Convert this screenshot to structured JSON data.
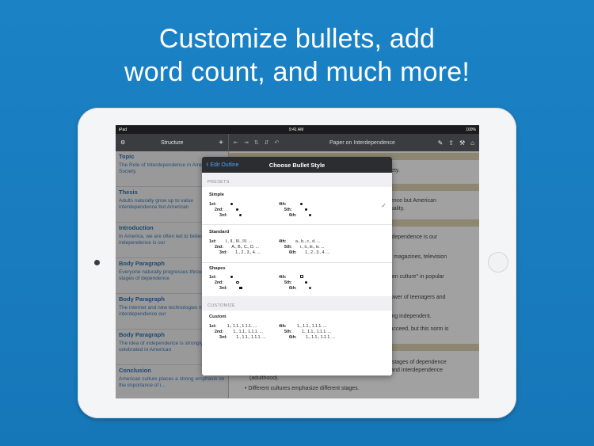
{
  "headline": {
    "line1": "Customize bullets, add",
    "line2": "word count, and much more!"
  },
  "status_bar": {
    "device": "iPad",
    "time": "9:41 AM",
    "battery": "100%"
  },
  "sidebar": {
    "title": "Structure",
    "settings_icon": "gear-icon",
    "add_label": "+",
    "items": [
      {
        "title": "Topic",
        "text": "The Role of Interdependence in American Society."
      },
      {
        "title": "Thesis",
        "text": "Adults naturally grow up to value interdependence but American"
      },
      {
        "title": "Introduction",
        "text": "In America, we are often led to believe that independence is our"
      },
      {
        "title": "Body Paragraph",
        "text": "Everyone naturally progresses through the life stages of dependence"
      },
      {
        "title": "Body Paragraph",
        "text": "The internet and new technologies make interdependence our"
      },
      {
        "title": "Body Paragraph",
        "text": "The idea of independence is strongly celebrated in American"
      },
      {
        "title": "Conclusion",
        "text": "American culture places a strong emphasis on the importance of i..."
      }
    ]
  },
  "toolbar": {
    "doc_title": "Paper on Interdependence",
    "left_icons": [
      "outdent-icon",
      "indent-icon",
      "move-up-icon",
      "move-down-icon",
      "undo-icon"
    ],
    "right_icons": [
      "edit-icon",
      "share-icon",
      "wrench-icon",
      "home-icon"
    ]
  },
  "document": {
    "fragments": [
      "ciety.",
      "dence but American",
      "duality.",
      "independence is our",
      "ar magazines, television",
      "teen culture\" in popular",
      "power of teenagers and",
      "eing independent.",
      "succeed, but this norm is",
      "e stages of dependence",
      ") and interdependence",
      "(adulthood).",
      "Different cultures emphasize different stages."
    ]
  },
  "popover": {
    "back_label": "Edit Outline",
    "title": "Choose Bullet Style",
    "sections": {
      "presets": "PRESETS",
      "customize": "CUSTOMIZE"
    },
    "styles": {
      "simple": {
        "name": "Simple",
        "selected": true
      },
      "standard": {
        "name": "Standard",
        "l1": "I., II., III., IV. ...",
        "l2": "A., B., C., D. ...",
        "l3": "1., 2., 3., 4. ...",
        "l4": "a., b., c., d. ...",
        "l5": "i., ii., iii., iv. ...",
        "l6": "1., 2., 3., 4. ..."
      },
      "shapes": {
        "name": "Shapes"
      },
      "custom": {
        "name": "Custom",
        "l1": "1., 1.1., 1.1.1. ...",
        "l2": "1., 1.1., 1.1.1. ...",
        "l3": "1., 1.1., 1.1.1. ...",
        "l4": "1., 1.1., 1.1.1. ...",
        "l5": "1., 1.1., 1.1.1. ...",
        "l6": "1., 1.1., 1.1.1. ..."
      }
    },
    "level_labels": [
      "1st:",
      "2nd:",
      "3rd:",
      "4th:",
      "5th:",
      "6th:"
    ]
  },
  "colors": {
    "background": "#1b82c6",
    "accent": "#2f7fe0",
    "sidebar_text": "#3b78b8"
  }
}
